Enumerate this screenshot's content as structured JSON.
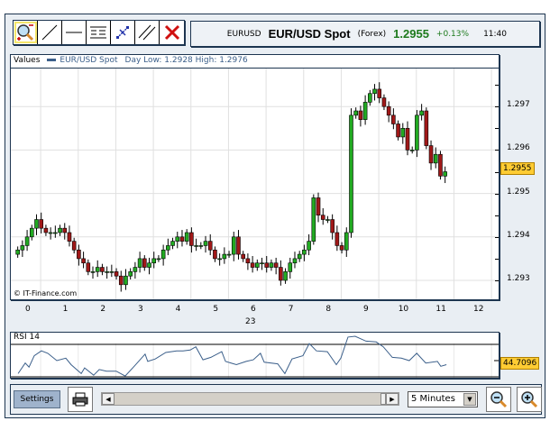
{
  "toolbar": {
    "tools": [
      {
        "name": "zoom-tool",
        "icon": "magnifier-zoom-icon",
        "active": true
      },
      {
        "name": "trend-line-tool",
        "icon": "diagonal-line-icon"
      },
      {
        "name": "horizontal-line-tool",
        "icon": "horizontal-line-icon"
      },
      {
        "name": "fibonacci-tool",
        "icon": "fibonacci-lines-icon"
      },
      {
        "name": "fan-tool",
        "icon": "cross-arrows-icon"
      },
      {
        "name": "channel-tool",
        "icon": "parallel-lines-icon"
      },
      {
        "name": "delete-tool",
        "icon": "red-x-icon"
      }
    ]
  },
  "quote": {
    "symbol": "EURUSD",
    "name": "EUR/USD Spot",
    "type": "(Forex)",
    "price": "1.2955",
    "change": "+0.13%",
    "time": "11:40"
  },
  "colors": {
    "up": "#22aa22",
    "down": "#a01818",
    "accent": "#1d3550",
    "marker": "#ffcc33",
    "price_green": "#1d7a1d"
  },
  "chart_data": [
    {
      "type": "candlestick",
      "header": {
        "label": "Values",
        "series_name": "EUR/USD Spot",
        "day_range": "Day Low: 1.2928 High: 1.2976"
      },
      "copyright": "© IT-Finance.com",
      "x_ticks": [
        "0",
        "1",
        "2",
        "3",
        "4",
        "5",
        "6",
        "7",
        "8",
        "9",
        "10",
        "11",
        "12"
      ],
      "x_sublabel": "23",
      "y_ticks": [
        "1.293",
        "1.294",
        "1.295",
        "1.296",
        "1.297"
      ],
      "ylim": [
        1.2926,
        1.2983
      ],
      "xlim": [
        -0.25,
        12.75
      ],
      "grid": true,
      "current_value": "1.2955",
      "start_hour": -0.2,
      "step_hours": 0.125,
      "closes": [
        1.2937,
        1.2938,
        1.294,
        1.2942,
        1.2944,
        1.2942,
        1.2941,
        1.2941,
        1.2941,
        1.2942,
        1.2941,
        1.2939,
        1.2937,
        1.2935,
        1.2934,
        1.2932,
        1.2932,
        1.2933,
        1.2932,
        1.2932,
        1.2932,
        1.2931,
        1.2929,
        1.2931,
        1.2932,
        1.2933,
        1.2935,
        1.2933,
        1.2934,
        1.2935,
        1.2935,
        1.2937,
        1.2938,
        1.2939,
        1.294,
        1.2939,
        1.2941,
        1.2938,
        1.2938,
        1.2938,
        1.2939,
        1.2937,
        1.2935,
        1.2935,
        1.2936,
        1.2936,
        1.294,
        1.2936,
        1.2935,
        1.2934,
        1.2933,
        1.2934,
        1.2934,
        1.2933,
        1.2934,
        1.2933,
        1.293,
        1.2932,
        1.2934,
        1.2935,
        1.2936,
        1.2937,
        1.2939,
        1.2949,
        1.2945,
        1.2944,
        1.2944,
        1.2941,
        1.2938,
        1.2937,
        1.2941,
        1.2968,
        1.2969,
        1.2967,
        1.2971,
        1.2973,
        1.2974,
        1.2972,
        1.297,
        1.2968,
        1.2966,
        1.2963,
        1.2965,
        1.296,
        1.296,
        1.2968,
        1.2969,
        1.2961,
        1.2957,
        1.2959,
        1.2954,
        1.2955
      ]
    },
    {
      "type": "line",
      "title": "RSI 14",
      "ylim": [
        30,
        70
      ],
      "current_value": "44.7096",
      "points": [
        [
          -0.19,
          34
        ],
        [
          0,
          47
        ],
        [
          0.1,
          42
        ],
        [
          0.24,
          56
        ],
        [
          0.43,
          62
        ],
        [
          0.6,
          59
        ],
        [
          0.84,
          50
        ],
        [
          1.08,
          53
        ],
        [
          1.22,
          45
        ],
        [
          1.49,
          34
        ],
        [
          1.58,
          41
        ],
        [
          1.82,
          32
        ],
        [
          1.97,
          39
        ],
        [
          2.16,
          37
        ],
        [
          2.42,
          37
        ],
        [
          2.66,
          31
        ],
        [
          2.9,
          43
        ],
        [
          3.19,
          58
        ],
        [
          3.26,
          49
        ],
        [
          3.46,
          52
        ],
        [
          3.74,
          60
        ],
        [
          4.03,
          62
        ],
        [
          4.2,
          62
        ],
        [
          4.39,
          63
        ],
        [
          4.54,
          67
        ],
        [
          4.73,
          51
        ],
        [
          4.94,
          54
        ],
        [
          5.23,
          61
        ],
        [
          5.33,
          49
        ],
        [
          5.62,
          45
        ],
        [
          5.88,
          49
        ],
        [
          6.07,
          51
        ],
        [
          6.26,
          59
        ],
        [
          6.36,
          48
        ],
        [
          6.72,
          46
        ],
        [
          6.91,
          34
        ],
        [
          7.1,
          52
        ],
        [
          7.39,
          56
        ],
        [
          7.56,
          71
        ],
        [
          7.75,
          62
        ],
        [
          8.04,
          61
        ],
        [
          8.28,
          45
        ],
        [
          8.4,
          53
        ],
        [
          8.59,
          79
        ],
        [
          8.78,
          80
        ],
        [
          9.07,
          74
        ],
        [
          9.34,
          73
        ],
        [
          9.53,
          67
        ],
        [
          9.77,
          54
        ],
        [
          10.01,
          53
        ],
        [
          10.22,
          50
        ],
        [
          10.42,
          59
        ],
        [
          10.66,
          47
        ],
        [
          10.97,
          49
        ],
        [
          11.06,
          43
        ],
        [
          11.21,
          45
        ]
      ]
    }
  ],
  "bottom": {
    "settings_label": "Settings",
    "interval": "5 Minutes"
  }
}
